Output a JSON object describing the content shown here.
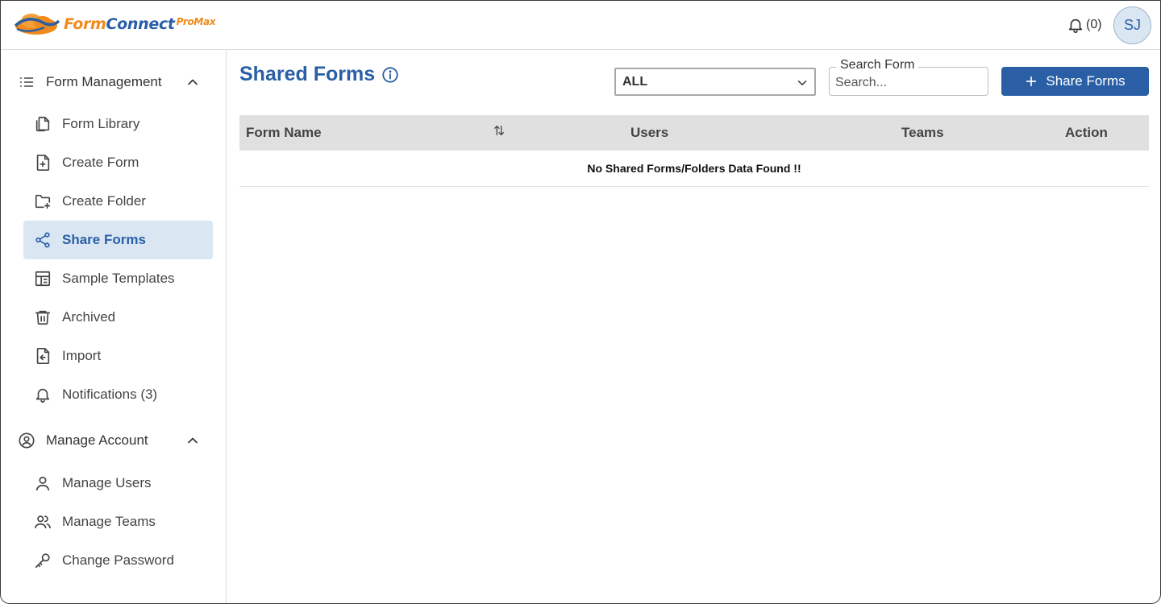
{
  "header": {
    "logo": {
      "form": "Form",
      "connect": "Connect",
      "suffix": "ProMax"
    },
    "notifications_label": "(0)",
    "avatar_initials": "SJ"
  },
  "sidebar": {
    "form_management": {
      "label": "Form Management",
      "items": [
        {
          "label": "Form Library",
          "icon": "files-icon"
        },
        {
          "label": "Create Form",
          "icon": "file-plus-icon"
        },
        {
          "label": "Create Folder",
          "icon": "folder-plus-icon"
        },
        {
          "label": "Share Forms",
          "icon": "share-icon",
          "active": true
        },
        {
          "label": "Sample Templates",
          "icon": "template-icon"
        },
        {
          "label": "Archived",
          "icon": "trash-icon"
        },
        {
          "label": "Import",
          "icon": "import-icon"
        },
        {
          "label": "Notifications (3)",
          "icon": "bell-icon"
        }
      ]
    },
    "manage_account": {
      "label": "Manage Account",
      "items": [
        {
          "label": "Manage Users",
          "icon": "user-icon"
        },
        {
          "label": "Manage Teams",
          "icon": "users-icon"
        },
        {
          "label": "Change Password",
          "icon": "key-icon"
        }
      ]
    }
  },
  "main": {
    "title": "Shared Forms",
    "filter": {
      "selected": "ALL"
    },
    "search": {
      "label": "Search Form",
      "placeholder": "Search..."
    },
    "share_button": "Share Forms",
    "table": {
      "columns": [
        "Form Name",
        "Users",
        "Teams",
        "Action"
      ],
      "empty_message": "No Shared Forms/Folders Data Found !!"
    }
  },
  "colors": {
    "accent": "#2a5fa6",
    "brand_orange": "#f08a1c",
    "active_bg": "#dbe6f3",
    "table_header_bg": "#e0e0e0"
  }
}
